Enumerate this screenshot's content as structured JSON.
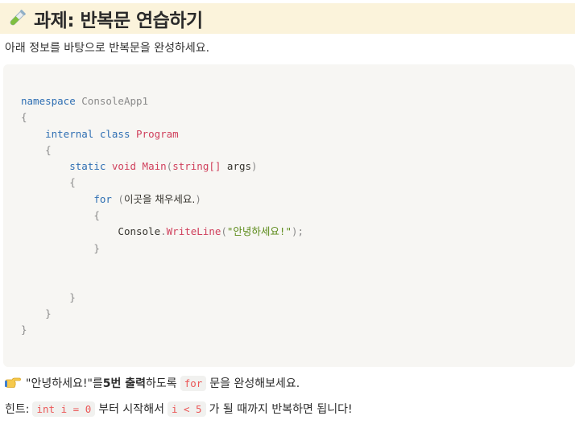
{
  "title": {
    "icon": "test-tube-icon",
    "text": "과제: 반복문 연습하기"
  },
  "subtitle": "아래 정보를 바탕으로 반복문을 완성하세요.",
  "code": {
    "ns_kw": "namespace",
    "ns_name": "ConsoleApp1",
    "open1": "{",
    "mod_internal": "internal",
    "kw_class": "class",
    "class_name": "Program",
    "open2": "{",
    "kw_static": "static",
    "kw_void": "void",
    "method_name": "Main",
    "paren_open": "(",
    "param_type": "string[]",
    "param_name": " args",
    "paren_close": ")",
    "open3": "{",
    "kw_for": "for",
    "for_open": " (",
    "for_placeholder": "이곳을 채우세요.",
    "for_close": ")",
    "open4": "{",
    "console": "Console",
    "dot": ".",
    "writeline": "WriteLine",
    "call_open": "(",
    "string_literal": "\"안녕하세요!\"",
    "call_close": ");",
    "close4": "}",
    "close3": "}",
    "close2": "}",
    "close1": "}"
  },
  "instruction": {
    "icon": "pointing-hand-icon",
    "part1": "\"안녕하세요!\"를 ",
    "bold": "5번 출력",
    "part2": "하도록 ",
    "code": "for",
    "part3": " 문을 완성해보세요."
  },
  "hint": {
    "label": "힌트: ",
    "code1": "int i = 0",
    "part1": "부터 시작해서 ",
    "code2": "i < 5",
    "part2": "가 될 때까지 반복하면 됩니다!"
  }
}
